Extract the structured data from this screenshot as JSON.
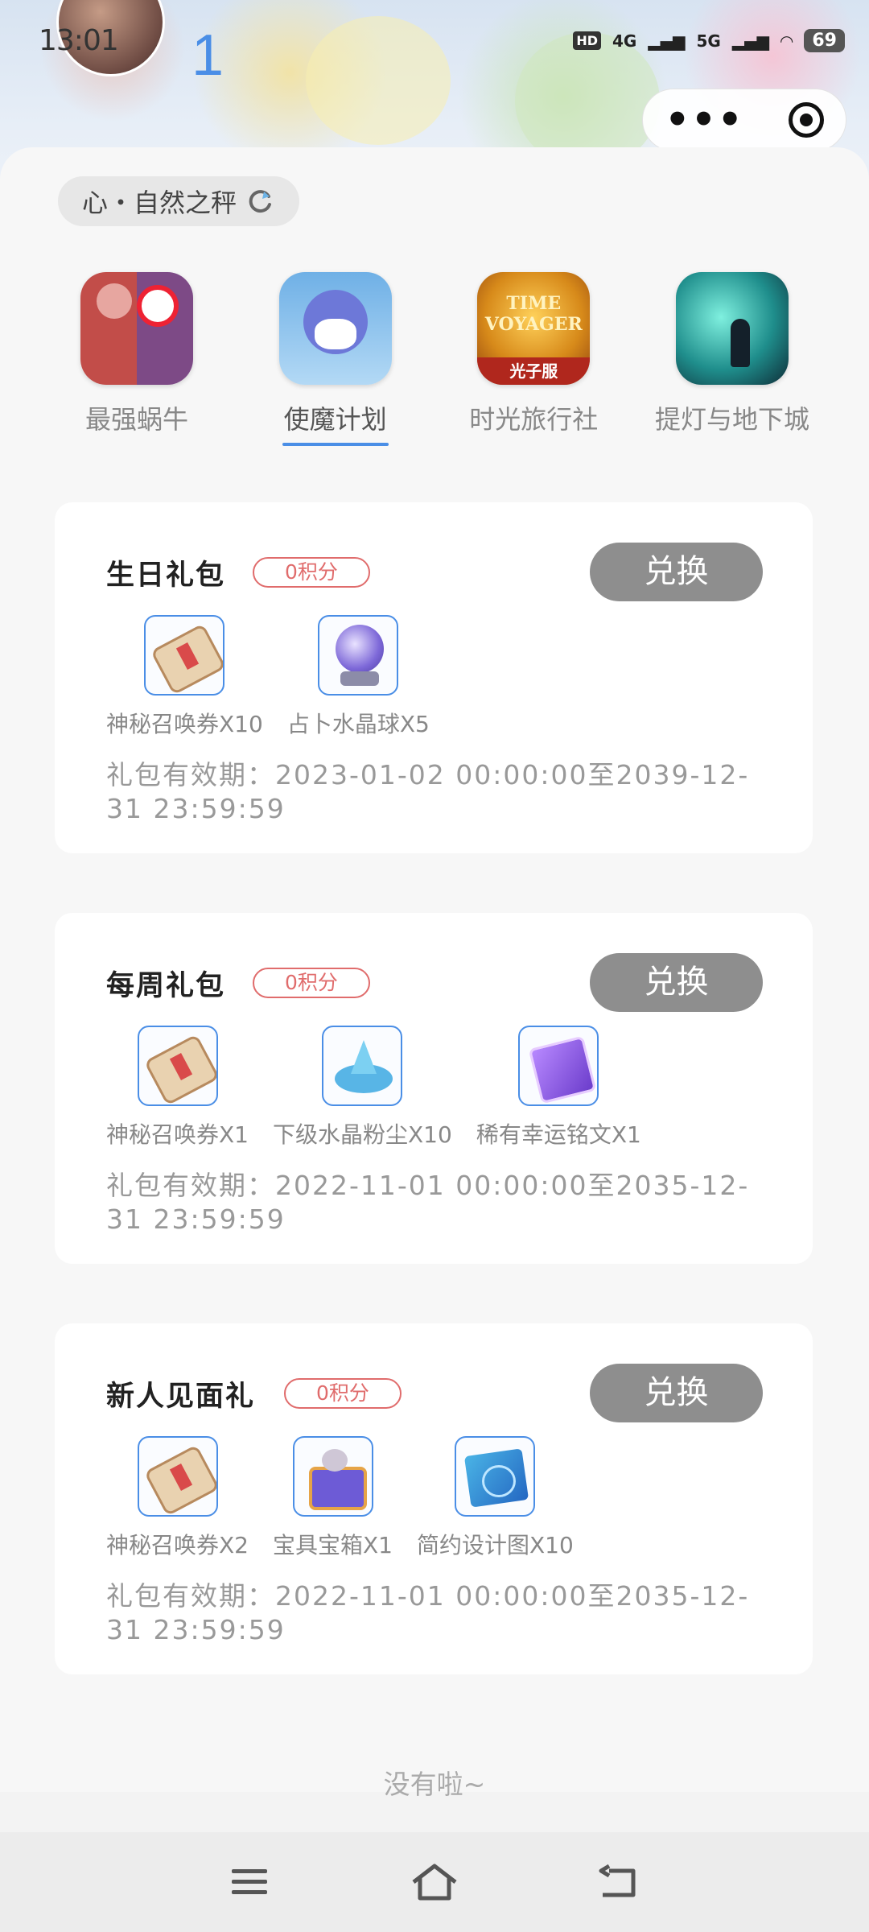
{
  "status_bar": {
    "time": "13:01",
    "network": [
      "HD",
      "4G",
      "5G"
    ],
    "battery": "69"
  },
  "header": {
    "count": "1"
  },
  "capsule": {
    "more_icon": "more-dots-icon",
    "close_icon": "target-close-icon"
  },
  "scale_chip": {
    "label": "心・自然之秤"
  },
  "games": [
    {
      "label": "最强蜗牛",
      "active": false
    },
    {
      "label": "使魔计划",
      "active": true
    },
    {
      "label": "时光旅行社",
      "active": false,
      "icon_text": "TIME VOYAGER",
      "badge": "光子服"
    },
    {
      "label": "提灯与地下城",
      "active": false
    }
  ],
  "gifts": [
    {
      "title": "生日礼包",
      "points": "0积分",
      "button": "兑换",
      "items": [
        {
          "label": "神秘召唤券X10",
          "icon": "scroll-icon"
        },
        {
          "label": "占卜水晶球X5",
          "icon": "crystal-ball-icon"
        }
      ],
      "validity": "礼包有效期：2023-01-02 00:00:00至2039-12-31 23:59:59"
    },
    {
      "title": "每周礼包",
      "points": "0积分",
      "button": "兑换",
      "items": [
        {
          "label": "神秘召唤券X1",
          "icon": "scroll-icon"
        },
        {
          "label": "下级水晶粉尘X10",
          "icon": "crystal-dust-icon"
        },
        {
          "label": "稀有幸运铭文X1",
          "icon": "rune-icon"
        }
      ],
      "validity": "礼包有效期：2022-11-01 00:00:00至2035-12-31 23:59:59"
    },
    {
      "title": "新人见面礼",
      "points": "0积分",
      "button": "兑换",
      "items": [
        {
          "label": "神秘召唤券X2",
          "icon": "scroll-icon"
        },
        {
          "label": "宝具宝箱X1",
          "icon": "treasure-chest-icon"
        },
        {
          "label": "简约设计图X10",
          "icon": "blueprint-icon"
        }
      ],
      "validity": "礼包有效期：2022-11-01 00:00:00至2035-12-31 23:59:59"
    }
  ],
  "footer": {
    "end_text": "没有啦~"
  },
  "navbar": {
    "menu_icon": "menu-icon",
    "home_icon": "home-icon",
    "back_icon": "back-icon"
  },
  "colors": {
    "accent": "#4a8ee6",
    "points": "#e06c6c",
    "button": "#8e8e8e"
  }
}
